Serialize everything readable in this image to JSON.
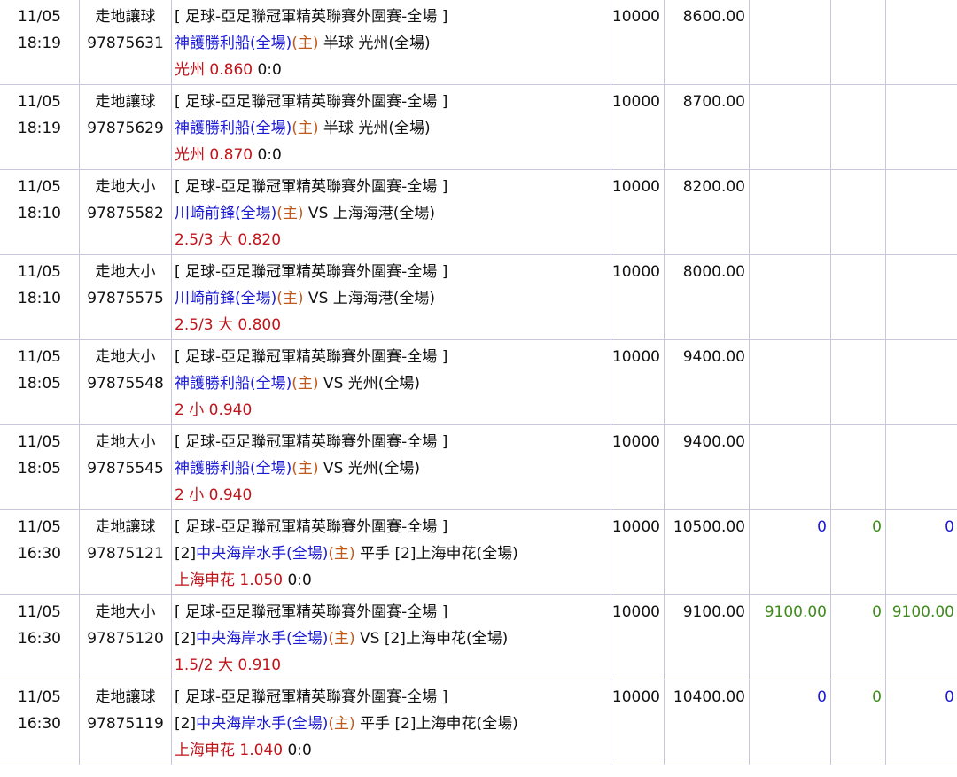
{
  "rows": [
    {
      "date": "11/05",
      "time": "18:19",
      "type": "走地讓球",
      "id": "97875631",
      "league": "[ 足球-亞足聯冠軍精英聯賽外圍賽-全場 ]",
      "prefix": "",
      "home": "神護勝利船(全場)",
      "home_tag": "(主)",
      "mid": " 半球 ",
      "away": "光州(全場)",
      "pick": "光州 0.860",
      "score": " 0:0",
      "stake": "10000",
      "amount": "8600.00",
      "r1": "",
      "r2": "",
      "r3": "",
      "r1_color": "",
      "r3_color": ""
    },
    {
      "date": "11/05",
      "time": "18:19",
      "type": "走地讓球",
      "id": "97875629",
      "league": "[ 足球-亞足聯冠軍精英聯賽外圍賽-全場 ]",
      "prefix": "",
      "home": "神護勝利船(全場)",
      "home_tag": "(主)",
      "mid": " 半球 ",
      "away": "光州(全場)",
      "pick": "光州 0.870",
      "score": " 0:0",
      "stake": "10000",
      "amount": "8700.00",
      "r1": "",
      "r2": "",
      "r3": "",
      "r1_color": "",
      "r3_color": ""
    },
    {
      "date": "11/05",
      "time": "18:10",
      "type": "走地大小",
      "id": "97875582",
      "league": "[ 足球-亞足聯冠軍精英聯賽外圍賽-全場 ]",
      "prefix": "",
      "home": "川崎前鋒(全場)",
      "home_tag": "(主)",
      "mid": " VS ",
      "away": "上海海港(全場)",
      "pick": "2.5/3 大 0.820",
      "score": "",
      "stake": "10000",
      "amount": "8200.00",
      "r1": "",
      "r2": "",
      "r3": "",
      "r1_color": "",
      "r3_color": ""
    },
    {
      "date": "11/05",
      "time": "18:10",
      "type": "走地大小",
      "id": "97875575",
      "league": "[ 足球-亞足聯冠軍精英聯賽外圍賽-全場 ]",
      "prefix": "",
      "home": "川崎前鋒(全場)",
      "home_tag": "(主)",
      "mid": " VS ",
      "away": "上海海港(全場)",
      "pick": "2.5/3 大 0.800",
      "score": "",
      "stake": "10000",
      "amount": "8000.00",
      "r1": "",
      "r2": "",
      "r3": "",
      "r1_color": "",
      "r3_color": ""
    },
    {
      "date": "11/05",
      "time": "18:05",
      "type": "走地大小",
      "id": "97875548",
      "league": "[ 足球-亞足聯冠軍精英聯賽外圍賽-全場 ]",
      "prefix": "",
      "home": "神護勝利船(全場)",
      "home_tag": "(主)",
      "mid": " VS ",
      "away": "光州(全場)",
      "pick": "2 小 0.940",
      "score": "",
      "stake": "10000",
      "amount": "9400.00",
      "r1": "",
      "r2": "",
      "r3": "",
      "r1_color": "",
      "r3_color": ""
    },
    {
      "date": "11/05",
      "time": "18:05",
      "type": "走地大小",
      "id": "97875545",
      "league": "[ 足球-亞足聯冠軍精英聯賽外圍賽-全場 ]",
      "prefix": "",
      "home": "神護勝利船(全場)",
      "home_tag": "(主)",
      "mid": " VS ",
      "away": "光州(全場)",
      "pick": "2 小 0.940",
      "score": "",
      "stake": "10000",
      "amount": "9400.00",
      "r1": "",
      "r2": "",
      "r3": "",
      "r1_color": "",
      "r3_color": ""
    },
    {
      "date": "11/05",
      "time": "16:30",
      "type": "走地讓球",
      "id": "97875121",
      "league": "[ 足球-亞足聯冠軍精英聯賽外圍賽-全場 ]",
      "prefix": "[2]",
      "home": "中央海岸水手(全場)",
      "home_tag": "(主)",
      "mid": " 平手 ",
      "away": "[2]上海申花(全場)",
      "pick": "上海申花 1.050",
      "score": " 0:0",
      "stake": "10000",
      "amount": "10500.00",
      "r1": "0",
      "r2": "0",
      "r3": "0",
      "r1_color": "#1a1ad6",
      "r3_color": "#1a1ad6"
    },
    {
      "date": "11/05",
      "time": "16:30",
      "type": "走地大小",
      "id": "97875120",
      "league": "[ 足球-亞足聯冠軍精英聯賽外圍賽-全場 ]",
      "prefix": "[2]",
      "home": "中央海岸水手(全場)",
      "home_tag": "(主)",
      "mid": " VS ",
      "away": "[2]上海申花(全場)",
      "pick": "1.5/2 大 0.910",
      "score": "",
      "stake": "10000",
      "amount": "9100.00",
      "r1": "9100.00",
      "r2": "0",
      "r3": "9100.00",
      "r1_color": "#3f8a1d",
      "r3_color": "#3f8a1d"
    },
    {
      "date": "11/05",
      "time": "16:30",
      "type": "走地讓球",
      "id": "97875119",
      "league": "[ 足球-亞足聯冠軍精英聯賽外圍賽-全場 ]",
      "prefix": "[2]",
      "home": "中央海岸水手(全場)",
      "home_tag": "(主)",
      "mid": " 平手 ",
      "away": "[2]上海申花(全場)",
      "pick": "上海申花 1.040",
      "score": " 0:0",
      "stake": "10000",
      "amount": "10400.00",
      "r1": "0",
      "r2": "0",
      "r3": "0",
      "r1_color": "#1a1ad6",
      "r3_color": "#1a1ad6"
    }
  ]
}
